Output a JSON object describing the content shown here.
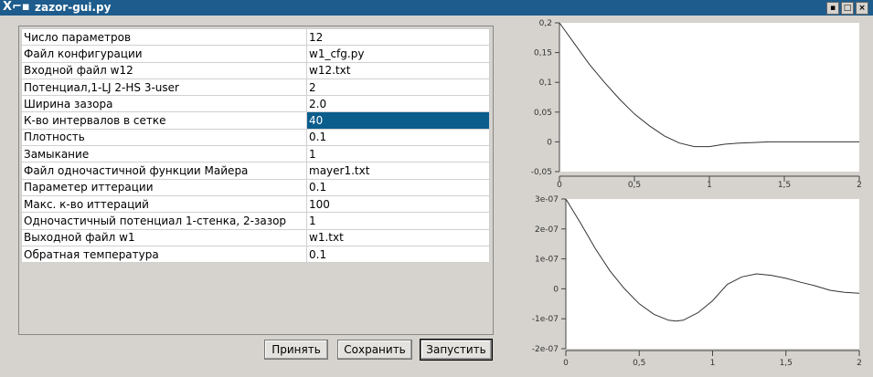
{
  "window": {
    "title": "zazor-gui.py",
    "minimize": "▪",
    "maximize": "□",
    "close": "×"
  },
  "params": [
    {
      "label": "Число параметров",
      "value": "12"
    },
    {
      "label": "Файл конфигурации",
      "value": "w1_cfg.py"
    },
    {
      "label": "Входной файл w12",
      "value": "w12.txt"
    },
    {
      "label": "Потенциал,1-LJ 2-HS 3-user",
      "value": "2"
    },
    {
      "label": "Ширина зазора",
      "value": "2.0"
    },
    {
      "label": "К-во интервалов в сетке",
      "value": "40"
    },
    {
      "label": "Плотность",
      "value": "0.1"
    },
    {
      "label": "Замыкание",
      "value": "1"
    },
    {
      "label": "Файл  одночастичной функции Майера",
      "value": "mayer1.txt"
    },
    {
      "label": "Параметер иттерации",
      "value": "0.1"
    },
    {
      "label": "Макс. к-во иттераций",
      "value": "100"
    },
    {
      "label": "Одночастичный потенциал 1-стенка, 2-зазор",
      "value": "1"
    },
    {
      "label": "Выходной файл w1",
      "value": "w1.txt"
    },
    {
      "label": "Обратная температура",
      "value": "0.1"
    }
  ],
  "selected_row": 5,
  "buttons": {
    "accept": "Принять",
    "save": "Сохранить",
    "run": "Запустить"
  },
  "chart_data": [
    {
      "type": "line",
      "xlim": [
        0,
        2
      ],
      "ylim": [
        -0.05,
        0.2
      ],
      "xticks": [
        "0",
        "0,5",
        "1",
        "1,5",
        "2"
      ],
      "yticks": [
        "0,2",
        "0,15",
        "0,1",
        "0,05",
        "0",
        "-0,05"
      ],
      "x": [
        0,
        0.1,
        0.2,
        0.3,
        0.4,
        0.5,
        0.6,
        0.7,
        0.8,
        0.9,
        1.0,
        1.1,
        1.2,
        1.3,
        1.4,
        1.6,
        1.8,
        2.0
      ],
      "y": [
        0.2,
        0.165,
        0.13,
        0.1,
        0.072,
        0.047,
        0.027,
        0.01,
        -0.002,
        -0.008,
        -0.008,
        -0.004,
        -0.002,
        -0.001,
        0,
        0,
        0,
        0
      ]
    },
    {
      "type": "line",
      "xlim": [
        0,
        2
      ],
      "ylim": [
        -2e-07,
        3e-07
      ],
      "xticks": [
        "0",
        "0,5",
        "1",
        "1,5",
        "2"
      ],
      "yticks": [
        "3e-07",
        "2e-07",
        "1e-07",
        "0",
        "-1e-07",
        "-2e-07"
      ],
      "x": [
        0,
        0.1,
        0.2,
        0.3,
        0.4,
        0.5,
        0.6,
        0.7,
        0.75,
        0.8,
        0.9,
        1.0,
        1.1,
        1.2,
        1.3,
        1.4,
        1.5,
        1.6,
        1.7,
        1.8,
        1.9,
        2.0
      ],
      "y": [
        3e-07,
        2.2e-07,
        1.35e-07,
        6e-08,
        0,
        -5e-08,
        -8.5e-08,
        -1.05e-07,
        -1.08e-07,
        -1.05e-07,
        -8e-08,
        -4e-08,
        1.5e-08,
        4e-08,
        5e-08,
        4.5e-08,
        3.5e-08,
        2.2e-08,
        1e-08,
        -5e-09,
        -1.2e-08,
        -1.5e-08
      ]
    }
  ]
}
